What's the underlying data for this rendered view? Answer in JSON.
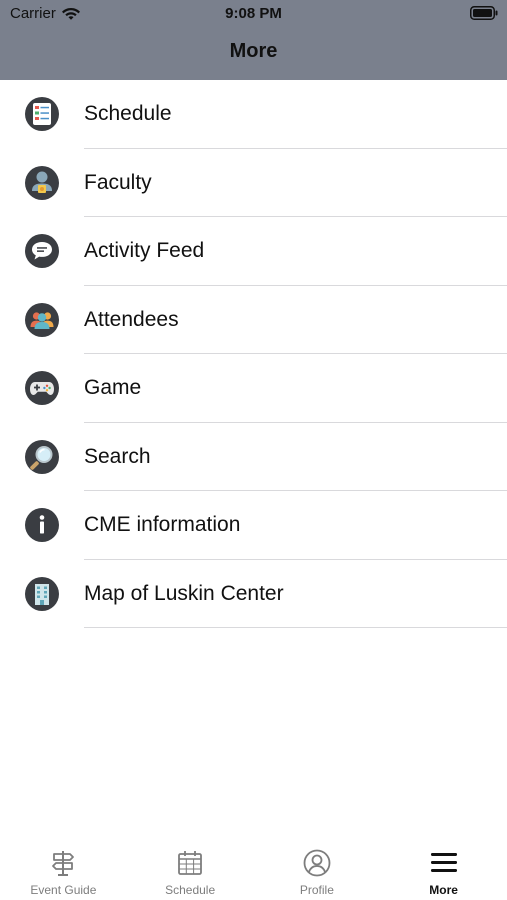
{
  "status_bar": {
    "carrier": "Carrier",
    "time": "9:08 PM",
    "wifi_icon": "wifi-icon",
    "battery_icon": "battery-icon"
  },
  "nav": {
    "title": "More"
  },
  "menu": {
    "items": [
      {
        "label": "Schedule",
        "icon": "schedule-icon"
      },
      {
        "label": "Faculty",
        "icon": "faculty-icon"
      },
      {
        "label": "Activity Feed",
        "icon": "chat-bubble-icon"
      },
      {
        "label": "Attendees",
        "icon": "attendees-icon"
      },
      {
        "label": "Game",
        "icon": "gamepad-icon"
      },
      {
        "label": "Search",
        "icon": "magnifier-icon"
      },
      {
        "label": "CME information",
        "icon": "info-icon"
      },
      {
        "label": "Map of Luskin Center",
        "icon": "building-icon"
      }
    ]
  },
  "tab_bar": {
    "tabs": [
      {
        "label": "Event Guide",
        "icon": "signpost-icon",
        "active": false
      },
      {
        "label": "Schedule",
        "icon": "calendar-icon",
        "active": false
      },
      {
        "label": "Profile",
        "icon": "profile-icon",
        "active": false
      },
      {
        "label": "More",
        "icon": "hamburger-icon",
        "active": true
      }
    ]
  },
  "colors": {
    "header_bg": "#7a808d",
    "icon_circle": "#3a3d42",
    "separator": "#d9d9dc",
    "tab_inactive": "#7d7d7d",
    "tab_active": "#111111"
  }
}
